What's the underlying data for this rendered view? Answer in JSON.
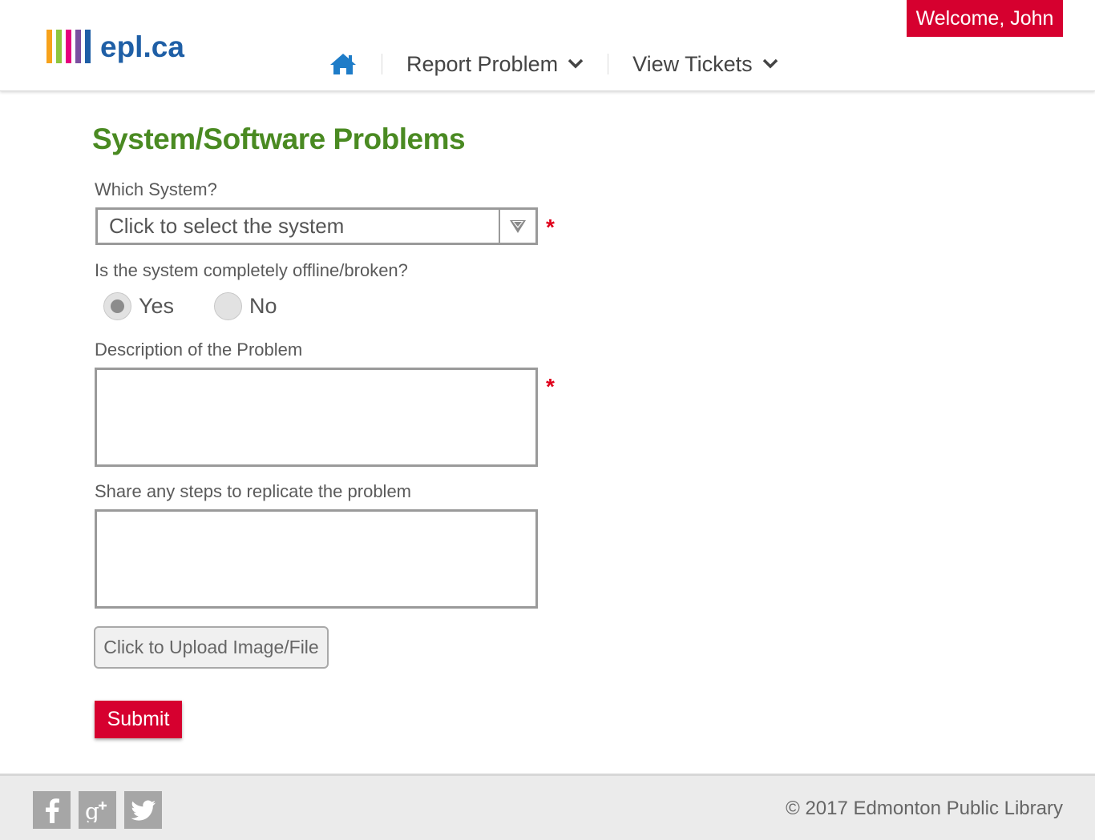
{
  "brand": {
    "logo_text": "epl.ca",
    "logo_bar_colors": [
      "#f7a21b",
      "#8dc63f",
      "#e6007e",
      "#7b4fa0",
      "#1f5fa6"
    ]
  },
  "nav": {
    "home_icon": "home-icon",
    "items": [
      {
        "label": "Report Problem",
        "icon": "chevron-down-icon"
      },
      {
        "label": "View Tickets",
        "icon": "chevron-down-icon"
      }
    ]
  },
  "user": {
    "welcome_label": "Welcome, John"
  },
  "page": {
    "title": "System/Software Problems"
  },
  "form": {
    "system_label": "Which System?",
    "system_value": "Click to select the system",
    "required_marker": "*",
    "offline_label": "Is the system completely offline/broken?",
    "offline_options": [
      {
        "label": "Yes",
        "selected": true
      },
      {
        "label": "No",
        "selected": false
      }
    ],
    "description_label": "Description of the Problem",
    "description_value": "",
    "steps_label": "Share any steps to replicate the problem",
    "steps_value": "",
    "upload_label": "Click to Upload Image/File",
    "submit_label": "Submit"
  },
  "footer": {
    "social": [
      "facebook-icon",
      "google-plus-icon",
      "twitter-icon"
    ],
    "copyright": "© 2017 Edmonton Public Library"
  },
  "colors": {
    "accent_red": "#d6002f",
    "title_green": "#4a8a22",
    "home_blue": "#1e7cc8",
    "required_red": "#e0001b"
  }
}
